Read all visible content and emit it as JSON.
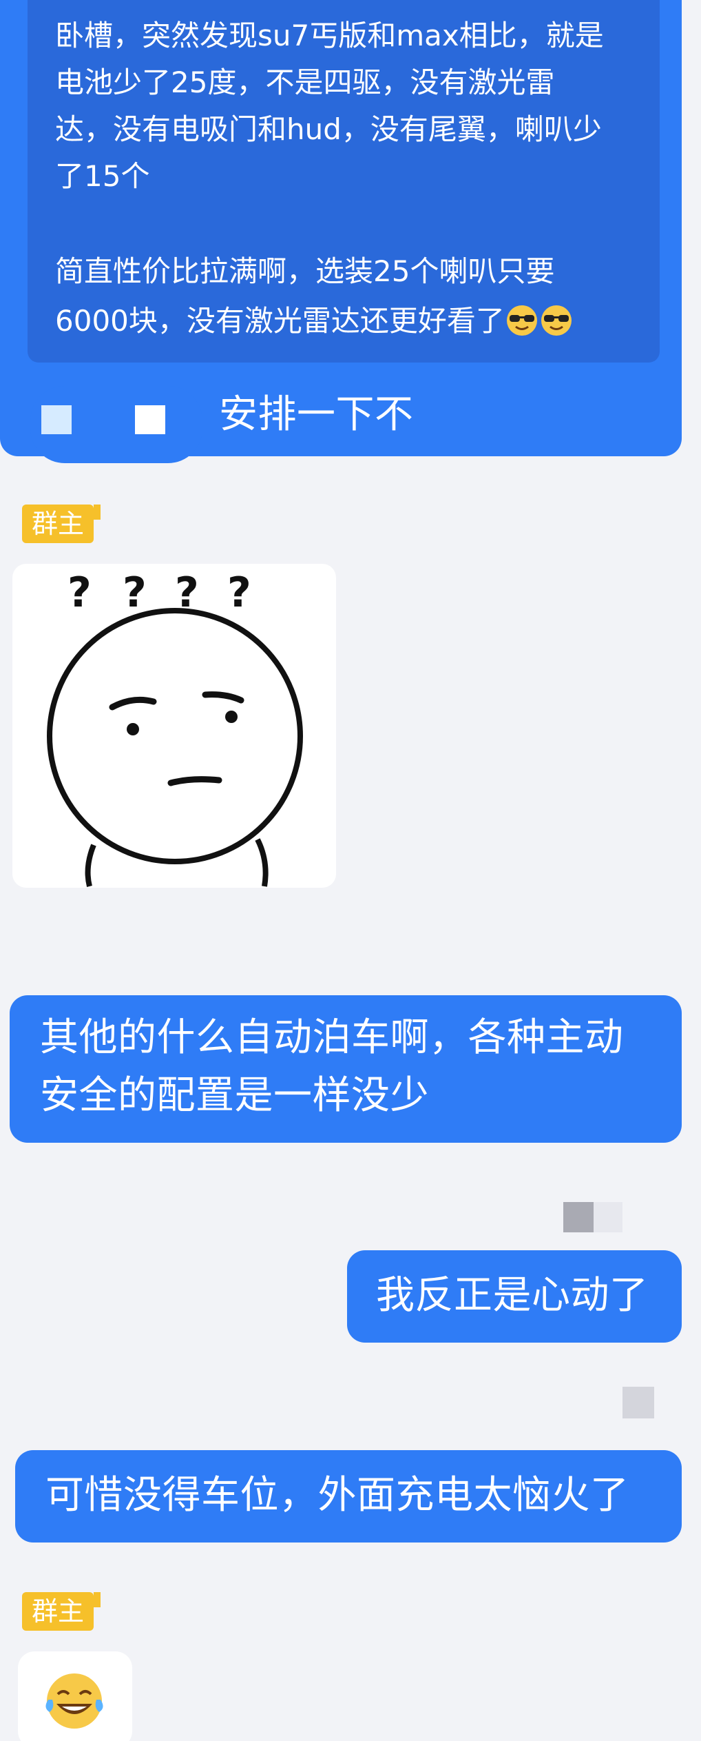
{
  "messages": {
    "quoted": {
      "lines": [
        "卧槽，突然发现su7丐版和max相比，就是",
        "电池少了25度，不是四驱，没有激光雷",
        "达，没有电吸门和hud，没有尾翼，喇叭少",
        "了15个",
        "简直性价比拉满啊，选装25个喇叭只要",
        "6000块，没有激光雷达还更好看了"
      ],
      "emoji_1": "sunglasses-face",
      "emoji_2": "sunglasses-face"
    },
    "reply_text": "安排一下不",
    "admin_badge": "群主",
    "sticker": "confused-face-question-marks",
    "msg_1_line_1": "其他的什么自动泊车啊，各种主动",
    "msg_1_line_2": "安全的配置是一样没少",
    "msg_2": "我反正是心动了",
    "msg_3": "可惜没得车位，外面充电太恼火了",
    "admin_badge_2": "群主",
    "emoji_reply": "tears-of-joy-face"
  },
  "colors": {
    "bubble": "#2f7cf6",
    "quote": "#2a69da",
    "badge": "#f6c02a",
    "background": "#f2f3f7"
  }
}
